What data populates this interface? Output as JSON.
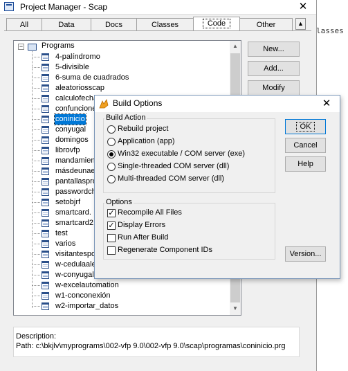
{
  "pm": {
    "title": "Project Manager - Scap",
    "close_glyph": "✕",
    "tabs": [
      {
        "label": "All",
        "active": false
      },
      {
        "label": "Data",
        "active": false
      },
      {
        "label": "Docs",
        "active": false
      },
      {
        "label": "Classes",
        "active": false
      },
      {
        "label": "Code",
        "active": true
      },
      {
        "label": "Other",
        "active": false
      }
    ],
    "tab_scroll_glyph": "▲",
    "tree": {
      "root_label": "Programs",
      "root_toggle": "−",
      "items": [
        {
          "label": "4-palíndromo"
        },
        {
          "label": "5-divisible"
        },
        {
          "label": "6-suma de cuadrados"
        },
        {
          "label": "aleatoriosscap"
        },
        {
          "label": "calculofecha"
        },
        {
          "label": "confuncione"
        },
        {
          "label": "coninicio",
          "selected": true
        },
        {
          "label": "conyugal"
        },
        {
          "label": "domingos"
        },
        {
          "label": "librovfp"
        },
        {
          "label": "mandamient"
        },
        {
          "label": "másdeunaes"
        },
        {
          "label": "pantallaspro"
        },
        {
          "label": "passwordch"
        },
        {
          "label": "setobjrf"
        },
        {
          "label": "smartcard."
        },
        {
          "label": "smartcard2."
        },
        {
          "label": "test"
        },
        {
          "label": "varios"
        },
        {
          "label": "visitantespor"
        },
        {
          "label": "w-cedulaale"
        },
        {
          "label": "w-conyugali"
        },
        {
          "label": "w-excelautomation"
        },
        {
          "label": "w1-conconexión"
        },
        {
          "label": "w2-importar_datos"
        }
      ]
    },
    "scroll_up_glyph": "▲",
    "scroll_down_glyph": "▼",
    "buttons": {
      "new": "New...",
      "add": "Add...",
      "modify": "Modify"
    },
    "description_label": "Description:",
    "path": "Path: c:\\bkjlv\\myprograms\\002-vfp 9.0\\002-vfp 9.0\\scap\\programas\\coninicio.prg"
  },
  "background_text": "lasses",
  "dialog": {
    "title": "Build Options",
    "close_glyph": "✕",
    "build_action": {
      "label": "Build Action",
      "options": [
        {
          "label": "Rebuild project",
          "selected": false
        },
        {
          "label": "Application (app)",
          "selected": false
        },
        {
          "label": "Win32 executable / COM server (exe)",
          "selected": true
        },
        {
          "label": "Single-threaded COM server (dll)",
          "selected": false
        },
        {
          "label": "Multi-threaded COM server (dll)",
          "selected": false
        }
      ]
    },
    "options": {
      "label": "Options",
      "items": [
        {
          "label": "Recompile All Files",
          "checked": true
        },
        {
          "label": "Display Errors",
          "checked": true
        },
        {
          "label": "Run After Build",
          "checked": false
        },
        {
          "label": "Regenerate Component IDs",
          "checked": false
        }
      ]
    },
    "check_glyph": "✓",
    "buttons": {
      "ok": "OK",
      "cancel": "Cancel",
      "help": "Help",
      "version": "Version..."
    }
  }
}
